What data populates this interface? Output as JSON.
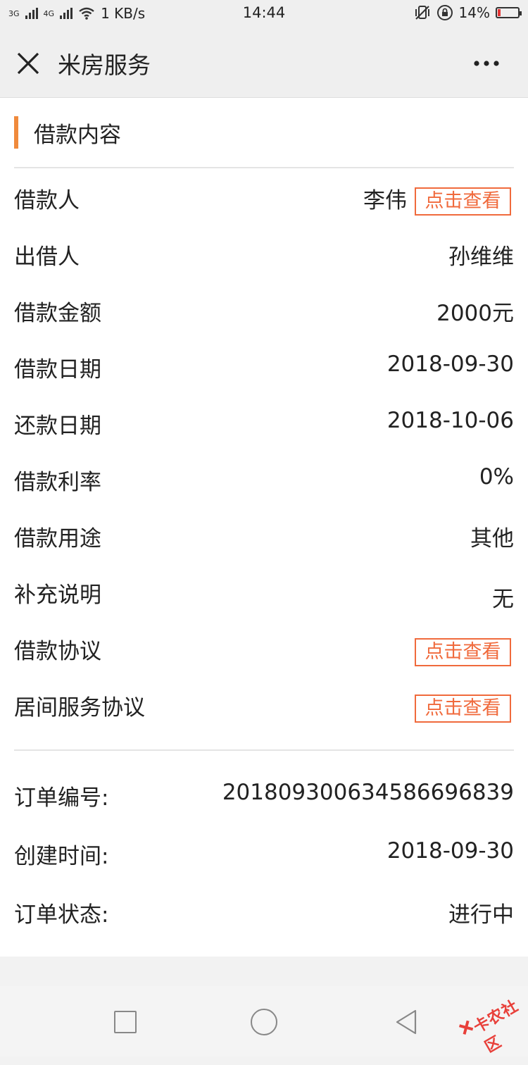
{
  "status_bar": {
    "net_3g": "3G",
    "net_4g": "4G",
    "speed": "1 KB/s",
    "time": "14:44",
    "battery_percent": "14%",
    "battery_level": 0.14,
    "battery_color": "#e33333"
  },
  "header": {
    "title": "米房服务",
    "close_icon": "close-icon",
    "more_icon": "more-icon"
  },
  "section": {
    "title": "借款内容",
    "accent_color": "#f08a3c"
  },
  "details": {
    "borrower_label": "借款人",
    "borrower_value": "李伟",
    "borrower_link": "点击查看",
    "lender_label": "出借人",
    "lender_value": "孙维维",
    "amount_label": "借款金额",
    "amount_value": "2000元",
    "loan_date_label": "借款日期",
    "loan_date_value": "2018-09-30",
    "repay_date_label": "还款日期",
    "repay_date_value": "2018-10-06",
    "rate_label": "借款利率",
    "rate_value": "0%",
    "purpose_label": "借款用途",
    "purpose_value": "其他",
    "note_label": "补充说明",
    "note_value": "无",
    "agreement_label": "借款协议",
    "agreement_link": "点击查看",
    "service_agreement_label": "居间服务协议",
    "service_agreement_link": "点击查看",
    "link_color": "#f06a3c"
  },
  "order": {
    "number_label": "订单编号:",
    "number_value": "2018093006345866968​39",
    "created_label": "创建时间:",
    "created_value": "2018-09-30",
    "status_label": "订单状态:",
    "status_value": "进行中"
  },
  "watermark": {
    "text": "卡农社区"
  }
}
